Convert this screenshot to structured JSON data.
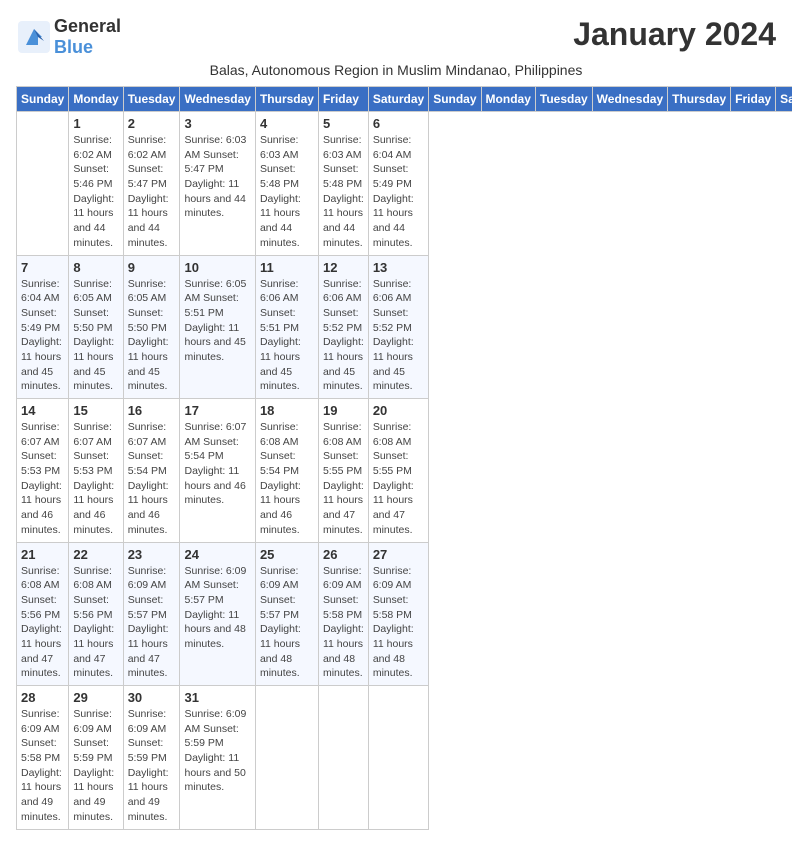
{
  "logo": {
    "general": "General",
    "blue": "Blue"
  },
  "month": "January 2024",
  "subtitle": "Balas, Autonomous Region in Muslim Mindanao, Philippines",
  "days_header": [
    "Sunday",
    "Monday",
    "Tuesday",
    "Wednesday",
    "Thursday",
    "Friday",
    "Saturday"
  ],
  "weeks": [
    [
      {
        "num": "",
        "info": ""
      },
      {
        "num": "1",
        "info": "Sunrise: 6:02 AM\nSunset: 5:46 PM\nDaylight: 11 hours\nand 44 minutes."
      },
      {
        "num": "2",
        "info": "Sunrise: 6:02 AM\nSunset: 5:47 PM\nDaylight: 11 hours\nand 44 minutes."
      },
      {
        "num": "3",
        "info": "Sunrise: 6:03 AM\nSunset: 5:47 PM\nDaylight: 11 hours\nand 44 minutes."
      },
      {
        "num": "4",
        "info": "Sunrise: 6:03 AM\nSunset: 5:48 PM\nDaylight: 11 hours\nand 44 minutes."
      },
      {
        "num": "5",
        "info": "Sunrise: 6:03 AM\nSunset: 5:48 PM\nDaylight: 11 hours\nand 44 minutes."
      },
      {
        "num": "6",
        "info": "Sunrise: 6:04 AM\nSunset: 5:49 PM\nDaylight: 11 hours\nand 44 minutes."
      }
    ],
    [
      {
        "num": "7",
        "info": "Sunrise: 6:04 AM\nSunset: 5:49 PM\nDaylight: 11 hours\nand 45 minutes."
      },
      {
        "num": "8",
        "info": "Sunrise: 6:05 AM\nSunset: 5:50 PM\nDaylight: 11 hours\nand 45 minutes."
      },
      {
        "num": "9",
        "info": "Sunrise: 6:05 AM\nSunset: 5:50 PM\nDaylight: 11 hours\nand 45 minutes."
      },
      {
        "num": "10",
        "info": "Sunrise: 6:05 AM\nSunset: 5:51 PM\nDaylight: 11 hours\nand 45 minutes."
      },
      {
        "num": "11",
        "info": "Sunrise: 6:06 AM\nSunset: 5:51 PM\nDaylight: 11 hours\nand 45 minutes."
      },
      {
        "num": "12",
        "info": "Sunrise: 6:06 AM\nSunset: 5:52 PM\nDaylight: 11 hours\nand 45 minutes."
      },
      {
        "num": "13",
        "info": "Sunrise: 6:06 AM\nSunset: 5:52 PM\nDaylight: 11 hours\nand 45 minutes."
      }
    ],
    [
      {
        "num": "14",
        "info": "Sunrise: 6:07 AM\nSunset: 5:53 PM\nDaylight: 11 hours\nand 46 minutes."
      },
      {
        "num": "15",
        "info": "Sunrise: 6:07 AM\nSunset: 5:53 PM\nDaylight: 11 hours\nand 46 minutes."
      },
      {
        "num": "16",
        "info": "Sunrise: 6:07 AM\nSunset: 5:54 PM\nDaylight: 11 hours\nand 46 minutes."
      },
      {
        "num": "17",
        "info": "Sunrise: 6:07 AM\nSunset: 5:54 PM\nDaylight: 11 hours\nand 46 minutes."
      },
      {
        "num": "18",
        "info": "Sunrise: 6:08 AM\nSunset: 5:54 PM\nDaylight: 11 hours\nand 46 minutes."
      },
      {
        "num": "19",
        "info": "Sunrise: 6:08 AM\nSunset: 5:55 PM\nDaylight: 11 hours\nand 47 minutes."
      },
      {
        "num": "20",
        "info": "Sunrise: 6:08 AM\nSunset: 5:55 PM\nDaylight: 11 hours\nand 47 minutes."
      }
    ],
    [
      {
        "num": "21",
        "info": "Sunrise: 6:08 AM\nSunset: 5:56 PM\nDaylight: 11 hours\nand 47 minutes."
      },
      {
        "num": "22",
        "info": "Sunrise: 6:08 AM\nSunset: 5:56 PM\nDaylight: 11 hours\nand 47 minutes."
      },
      {
        "num": "23",
        "info": "Sunrise: 6:09 AM\nSunset: 5:57 PM\nDaylight: 11 hours\nand 47 minutes."
      },
      {
        "num": "24",
        "info": "Sunrise: 6:09 AM\nSunset: 5:57 PM\nDaylight: 11 hours\nand 48 minutes."
      },
      {
        "num": "25",
        "info": "Sunrise: 6:09 AM\nSunset: 5:57 PM\nDaylight: 11 hours\nand 48 minutes."
      },
      {
        "num": "26",
        "info": "Sunrise: 6:09 AM\nSunset: 5:58 PM\nDaylight: 11 hours\nand 48 minutes."
      },
      {
        "num": "27",
        "info": "Sunrise: 6:09 AM\nSunset: 5:58 PM\nDaylight: 11 hours\nand 48 minutes."
      }
    ],
    [
      {
        "num": "28",
        "info": "Sunrise: 6:09 AM\nSunset: 5:58 PM\nDaylight: 11 hours\nand 49 minutes."
      },
      {
        "num": "29",
        "info": "Sunrise: 6:09 AM\nSunset: 5:59 PM\nDaylight: 11 hours\nand 49 minutes."
      },
      {
        "num": "30",
        "info": "Sunrise: 6:09 AM\nSunset: 5:59 PM\nDaylight: 11 hours\nand 49 minutes."
      },
      {
        "num": "31",
        "info": "Sunrise: 6:09 AM\nSunset: 5:59 PM\nDaylight: 11 hours\nand 50 minutes."
      },
      {
        "num": "",
        "info": ""
      },
      {
        "num": "",
        "info": ""
      },
      {
        "num": "",
        "info": ""
      }
    ]
  ]
}
